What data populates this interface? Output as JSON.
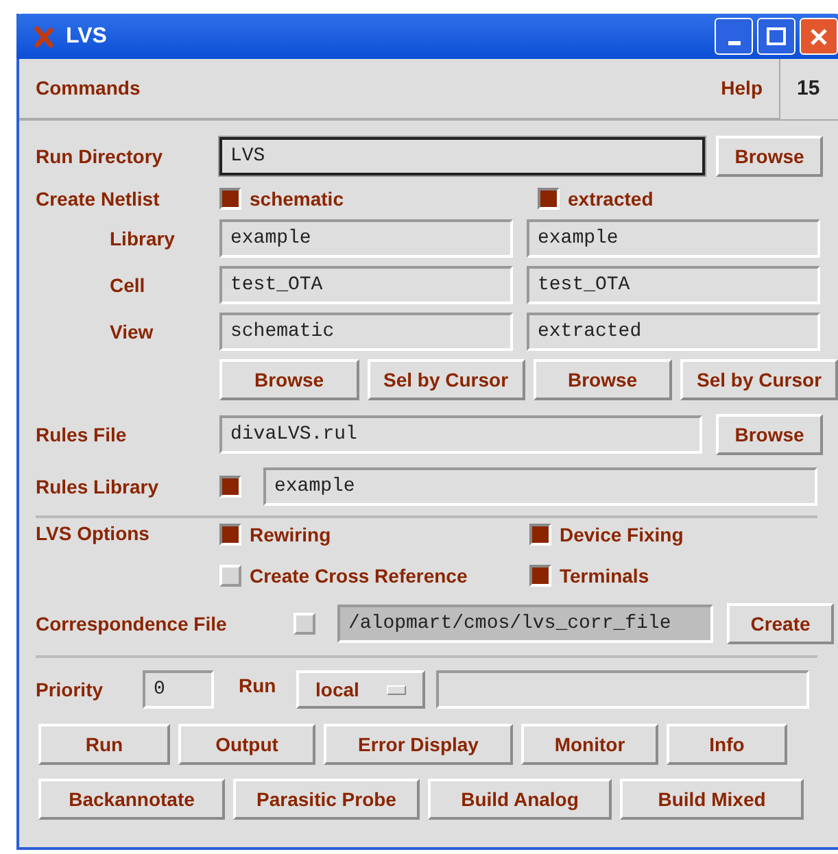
{
  "window": {
    "title": "LVS"
  },
  "menu": [
    {
      "label": "Commands"
    },
    {
      "label": "Help"
    }
  ],
  "menu_counter": "15",
  "run_directory": {
    "label": "Run Directory",
    "value": "LVS",
    "focused": true,
    "button": "Browse"
  },
  "create_netlist": {
    "label": "Create Netlist",
    "options": [
      {
        "label": "schematic",
        "checked": true
      },
      {
        "label": "extracted",
        "checked": true
      }
    ],
    "rows": [
      {
        "label": "Library",
        "values": [
          "example",
          "example"
        ]
      },
      {
        "label": "Cell",
        "values": [
          "test_OTA",
          "test_OTA"
        ]
      },
      {
        "label": "View",
        "values": [
          "schematic",
          "extracted"
        ]
      }
    ],
    "buttons": [
      "Browse",
      "Sel by Cursor",
      "Browse",
      "Sel by Cursor"
    ]
  },
  "rules_file": {
    "label": "Rules File",
    "value": "divaLVS.rul",
    "button": "Browse"
  },
  "rules_library": {
    "label": "Rules Library",
    "checked": true,
    "value": "example"
  },
  "lvs_options": {
    "label": "LVS Options",
    "options": [
      {
        "label": "Rewiring",
        "checked": true
      },
      {
        "label": "Device Fixing",
        "checked": true
      },
      {
        "label": "Create Cross Reference",
        "checked": false
      },
      {
        "label": "Terminals",
        "checked": true
      }
    ]
  },
  "correspondence_file": {
    "label": "Correspondence File",
    "checked": false,
    "value": "/alopmart/cmos/lvs_corr_file",
    "disabled": true,
    "button": "Create"
  },
  "priority": {
    "label": "Priority",
    "value": "0"
  },
  "run_mode": {
    "label": "Run",
    "value": "local"
  },
  "action_buttons": [
    [
      "Run",
      "Output",
      "Error Display",
      "Monitor",
      "Info"
    ],
    [
      "Backannotate",
      "Parasitic Probe",
      "Build Analog",
      "Build Mixed"
    ]
  ]
}
